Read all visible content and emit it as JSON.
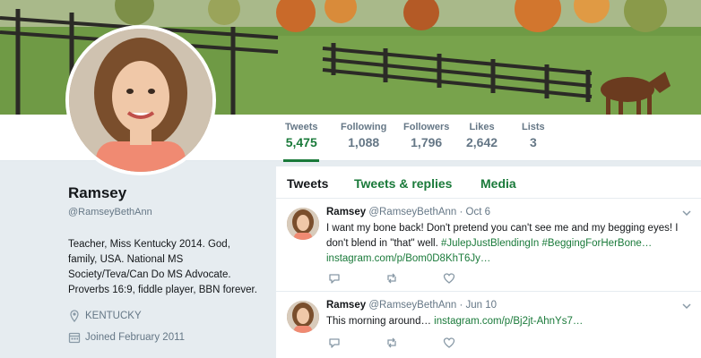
{
  "profile": {
    "name": "Ramsey",
    "handle": "@RamseyBethAnn",
    "bio": "Teacher, Miss Kentucky 2014. God, family, USA. National MS Society/Teva/Can Do MS Advocate. Proverbs 16:9, fiddle player, BBN forever.",
    "location": "KENTUCKY",
    "joined": "Joined February 2011"
  },
  "stats": [
    {
      "label": "Tweets",
      "value": "5,475"
    },
    {
      "label": "Following",
      "value": "1,088"
    },
    {
      "label": "Followers",
      "value": "1,796"
    },
    {
      "label": "Likes",
      "value": "2,642"
    },
    {
      "label": "Lists",
      "value": "3"
    }
  ],
  "tabs": [
    "Tweets",
    "Tweets & replies",
    "Media"
  ],
  "tweets": [
    {
      "name": "Ramsey",
      "handle": "@RamseyBethAnn",
      "date": "· Oct 6",
      "text": "I want my bone back! Don't pretend you can't see me and my begging eyes! I don't blend in \"that\" well. ",
      "hashtags": "#JulepJustBlendingIn #BeggingForHerBone…",
      "link": "instagram.com/p/Bom0D8KhT6Jy…"
    },
    {
      "name": "Ramsey",
      "handle": "@RamseyBethAnn",
      "date": "· Jun 10",
      "text": "This morning around… ",
      "link": "instagram.com/p/Bj2jt-AhnYs7…"
    }
  ],
  "icons": {
    "location": "location-pin-icon",
    "calendar": "calendar-icon",
    "reply": "reply-icon",
    "retweet": "retweet-icon",
    "like": "heart-icon",
    "caret": "chevron-down-icon"
  },
  "colors": {
    "accent": "#1a7a3a",
    "muted": "#657786",
    "background": "#e6ecf0"
  }
}
